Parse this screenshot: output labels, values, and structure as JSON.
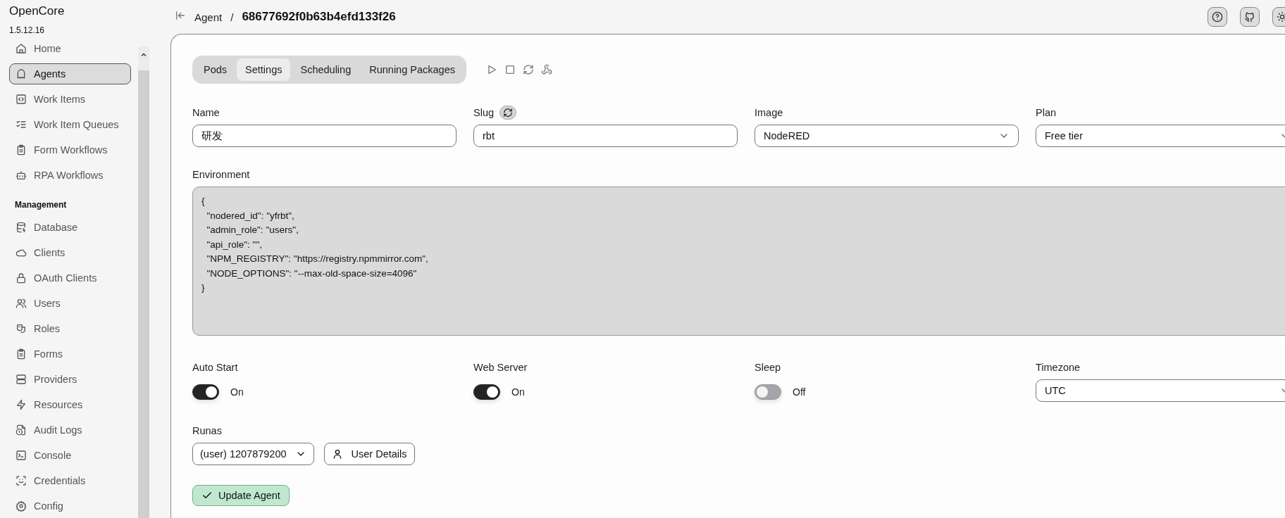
{
  "app": {
    "name": "OpenCore",
    "version": "1.5.12.16"
  },
  "sidebar": {
    "sections": [
      {
        "items": [
          {
            "label": "Home",
            "selected": false
          },
          {
            "label": "Agents",
            "selected": true
          },
          {
            "label": "Work Items",
            "selected": false
          },
          {
            "label": "Work Item Queues",
            "selected": false
          },
          {
            "label": "Form Workflows",
            "selected": false
          },
          {
            "label": "RPA Workflows",
            "selected": false
          }
        ]
      },
      {
        "heading": "Management",
        "items": [
          {
            "label": "Database",
            "selected": false
          },
          {
            "label": "Clients",
            "selected": false
          },
          {
            "label": "OAuth Clients",
            "selected": false
          },
          {
            "label": "Users",
            "selected": false
          },
          {
            "label": "Roles",
            "selected": false
          },
          {
            "label": "Forms",
            "selected": false
          },
          {
            "label": "Providers",
            "selected": false
          },
          {
            "label": "Resources",
            "selected": false
          },
          {
            "label": "Audit Logs",
            "selected": false
          },
          {
            "label": "Console",
            "selected": false
          },
          {
            "label": "Credentials",
            "selected": false
          },
          {
            "label": "Config",
            "selected": false
          }
        ]
      }
    ]
  },
  "header": {
    "breadcrumb": "Agent",
    "separator": "/",
    "title": "68677692f0b63b4efd133f26"
  },
  "tabs": [
    {
      "label": "Pods",
      "selected": false
    },
    {
      "label": "Settings",
      "selected": true
    },
    {
      "label": "Scheduling",
      "selected": false
    },
    {
      "label": "Running Packages",
      "selected": false
    }
  ],
  "fields": [
    {
      "label": "Name",
      "kind": "text",
      "value": "研发"
    },
    {
      "label": "Slug",
      "kind": "text",
      "value": "rbt",
      "refresh": true
    },
    {
      "label": "Image",
      "kind": "select",
      "value": "NodeRED"
    },
    {
      "label": "Plan",
      "kind": "select",
      "value": "Free tier"
    }
  ],
  "environment": {
    "label": "Environment",
    "value": "{\n  \"nodered_id\": \"yfrbt\",\n  \"admin_role\": \"users\",\n  \"api_role\": \"\",\n  \"NPM_REGISTRY\": \"https://registry.npmmirror.com\",\n  \"NODE_OPTIONS\": \"--max-old-space-size=4096\"\n}"
  },
  "options": [
    {
      "kind": "toggle",
      "label": "Auto Start",
      "on": true,
      "state_text": "On"
    },
    {
      "kind": "toggle",
      "label": "Web Server",
      "on": true,
      "state_text": "On"
    },
    {
      "kind": "toggle",
      "label": "Sleep",
      "on": false,
      "state_text": "Off"
    },
    {
      "kind": "select",
      "label": "Timezone",
      "value": "UTC"
    }
  ],
  "runas": {
    "label": "Runas",
    "value": "(user) 1207879200",
    "button": "User Details"
  },
  "submit": "Update Agent"
}
